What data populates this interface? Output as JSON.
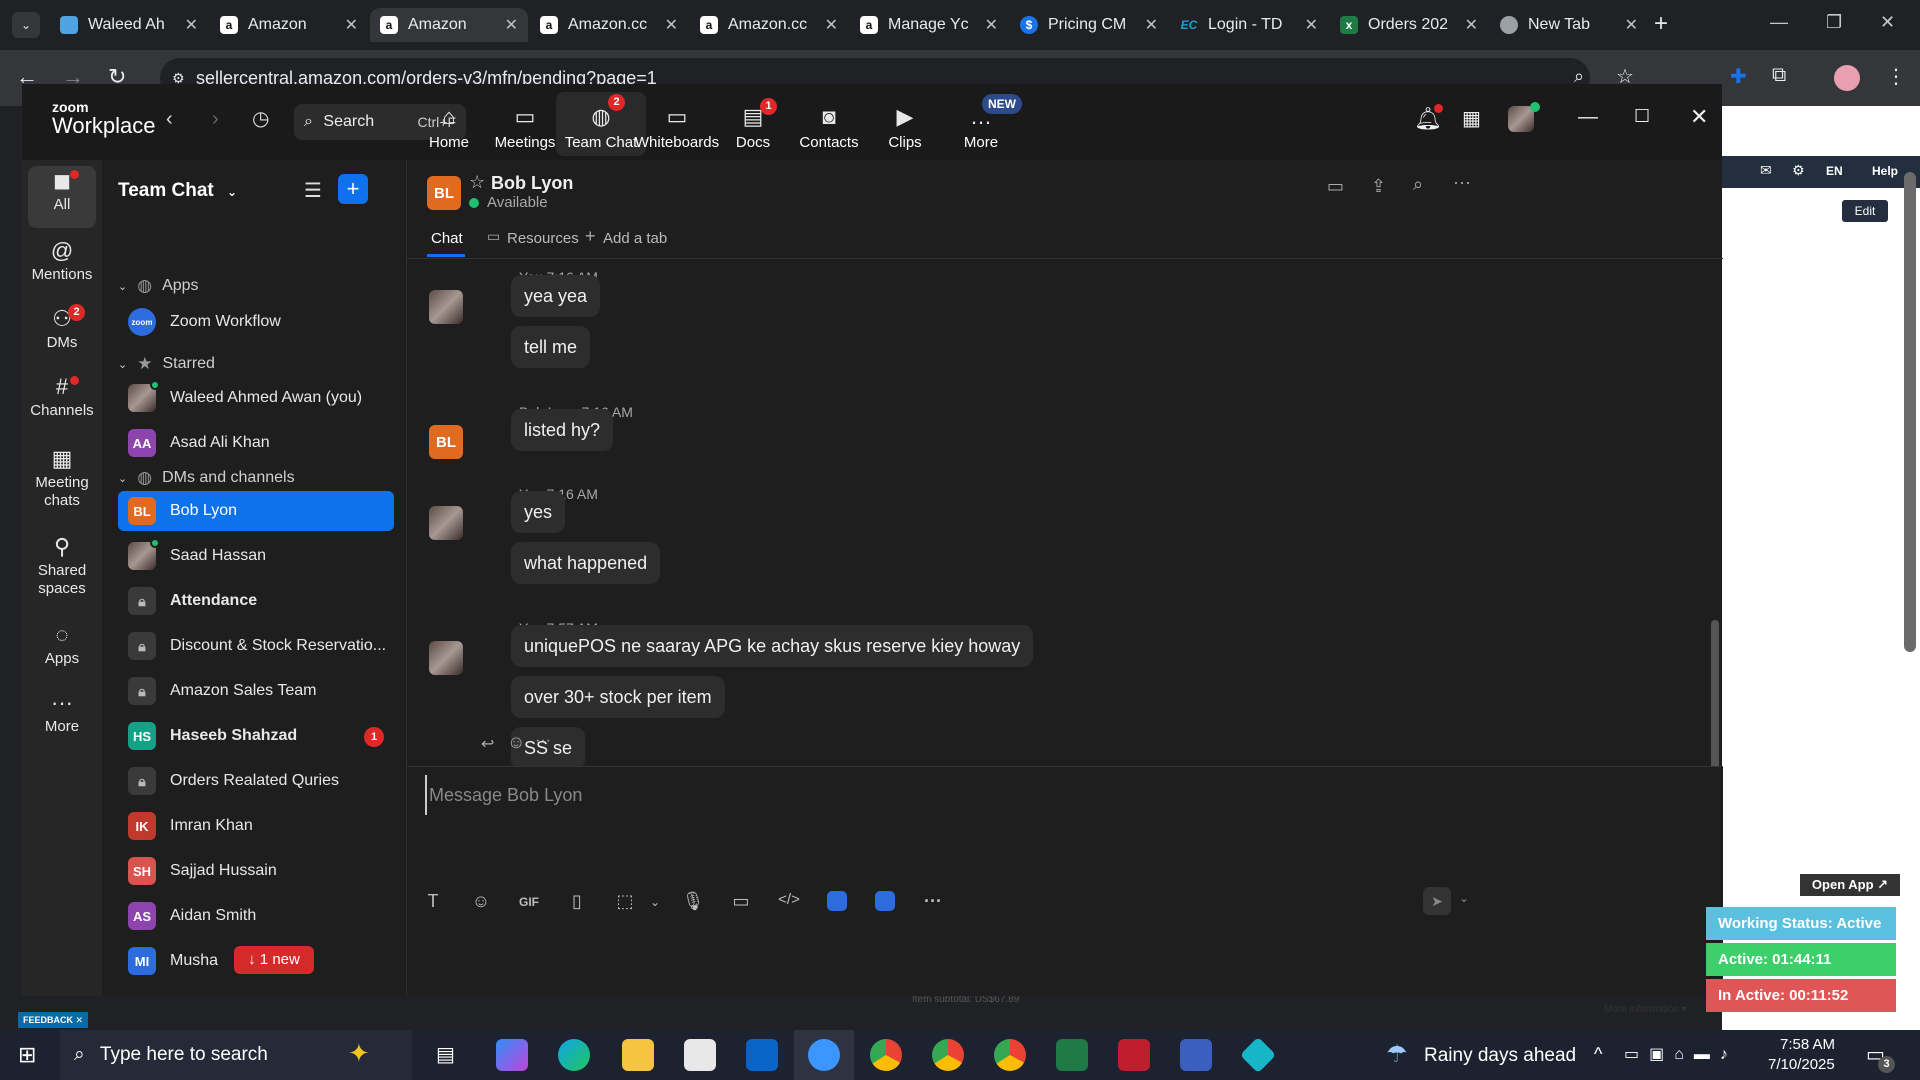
{
  "browser": {
    "tabs": [
      {
        "label": "Waleed Ah",
        "fav": "doc",
        "color": "#4fa3e0"
      },
      {
        "label": "Amazon",
        "fav": "a",
        "color": "#ffffff"
      },
      {
        "label": "Amazon",
        "fav": "a",
        "color": "#ffffff"
      },
      {
        "label": "Amazon.cc",
        "fav": "a",
        "color": "#ffffff"
      },
      {
        "label": "Amazon.cc",
        "fav": "a",
        "color": "#ffffff"
      },
      {
        "label": "Manage Yc",
        "fav": "a",
        "color": "#ffffff"
      },
      {
        "label": "Pricing CM",
        "fav": "$",
        "color": "#1a73e8"
      },
      {
        "label": "Login - TD",
        "fav": "EC",
        "color": "#1a9fd6"
      },
      {
        "label": "Orders 202",
        "fav": "x",
        "color": "#1f7a45"
      },
      {
        "label": "New Tab",
        "fav": "chrome",
        "color": "#9aa0a6"
      }
    ],
    "url": "sellercentral.amazon.com/orders-v3/mfn/pending?page=1"
  },
  "page_behind": {
    "help": "Help",
    "lang": "EN",
    "edit": "Edit",
    "open_app": "Open App ↗",
    "item_subtotal": "Item subtotal: US$67.89",
    "more_info": "More information ▾",
    "feedback": "FEEDBACK ✕"
  },
  "zoom": {
    "logo_top": "zoom",
    "logo_bottom": "Workplace",
    "search_label": "Search",
    "search_shortcut": "Ctrl+F",
    "nav": [
      {
        "label": "Home",
        "icon": "home-icon",
        "glyph": "⌂"
      },
      {
        "label": "Meetings",
        "icon": "video-icon",
        "glyph": "▭"
      },
      {
        "label": "Team Chat",
        "icon": "chat-icon",
        "glyph": "◍",
        "badge": "2"
      },
      {
        "label": "Whiteboards",
        "icon": "whiteboard-icon",
        "glyph": "▭"
      },
      {
        "label": "Docs",
        "icon": "docs-icon",
        "glyph": "▤",
        "badge": "1"
      },
      {
        "label": "Contacts",
        "icon": "contacts-icon",
        "glyph": "◙"
      },
      {
        "label": "Clips",
        "icon": "clips-icon",
        "glyph": "▶"
      },
      {
        "label": "More",
        "icon": "more-icon",
        "glyph": "…",
        "tag": "NEW"
      }
    ],
    "rail": [
      {
        "label": "All",
        "glyph": "◼"
      },
      {
        "label": "Mentions",
        "glyph": "@"
      },
      {
        "label": "DMs",
        "glyph": "⚇",
        "badge": "2"
      },
      {
        "label": "Channels",
        "glyph": "#"
      },
      {
        "label": "Meeting chats",
        "glyph": "▦"
      },
      {
        "label": "Shared spaces",
        "glyph": "⚲"
      },
      {
        "label": "Apps",
        "glyph": "◌"
      },
      {
        "label": "More",
        "glyph": "···"
      }
    ],
    "sidebar": {
      "title": "Team Chat",
      "sections": {
        "apps": "Apps",
        "starred": "Starred",
        "dms": "DMs and channels"
      },
      "apps_items": [
        {
          "label": "Zoom Workflow"
        }
      ],
      "starred_items": [
        {
          "label": "Waleed Ahmed Awan (you)",
          "type": "photo"
        },
        {
          "label": "Asad Ali Khan",
          "initials": "AA",
          "color": "#8e44ad"
        }
      ],
      "dm_items": [
        {
          "label": "Bob Lyon",
          "initials": "BL",
          "color": "#e06a20",
          "selected": true
        },
        {
          "label": "Saad Hassan",
          "type": "photo"
        },
        {
          "label": "Attendance",
          "type": "lock",
          "bold": true
        },
        {
          "label": "Discount & Stock Reservatio...",
          "type": "lock"
        },
        {
          "label": "Amazon Sales Team",
          "type": "lock"
        },
        {
          "label": "Haseeb Shahzad",
          "initials": "HS",
          "color": "#16a085",
          "bold": true,
          "badge": "1"
        },
        {
          "label": "Orders Realated Quries",
          "type": "lock"
        },
        {
          "label": "Imran Khan",
          "initials": "IK",
          "color": "#c0392b"
        },
        {
          "label": "Sajjad Hussain",
          "initials": "SH",
          "color": "#d9534f"
        },
        {
          "label": "Aidan Smith",
          "initials": "AS",
          "color": "#8e44ad"
        },
        {
          "label": "Musha",
          "initials": "MI",
          "color": "#2d6cdf"
        }
      ],
      "new_pill": "↓ 1 new"
    },
    "chat": {
      "contact_name": "Bob Lyon",
      "contact_initials": "BL",
      "contact_status": "Available",
      "tabs": [
        "Chat",
        "Resources",
        "Add a tab"
      ],
      "messages": [
        {
          "meta": "You 7:16 AM",
          "avatar": "photo",
          "bubbles": [
            "yea yea",
            "tell me"
          ]
        },
        {
          "meta": "Bob Lyon 7:16 AM",
          "avatar": "BL",
          "bubbles": [
            "listed hy?"
          ]
        },
        {
          "meta": "You 7:16 AM",
          "avatar": "photo",
          "bubbles": [
            "yes",
            "what happened"
          ]
        },
        {
          "meta": "You 7:57 AM",
          "avatar": "photo",
          "bubbles": [
            "uniquePOS ne saaray APG ke achay skus reserve kiey howay",
            "over 30+ stock per item",
            "SS se"
          ]
        }
      ],
      "composer_placeholder": "Message Bob Lyon",
      "toolbar": [
        "format-icon",
        "emoji-icon",
        "gif-icon",
        "file-icon",
        "screenshot-icon",
        "mic-icon",
        "video-message-icon",
        "code-icon",
        "app-icon",
        "zoom-doc-icon",
        "more-icon"
      ],
      "gif_label": "GIF"
    }
  },
  "overlay": {
    "working_status": "Working Status: Active",
    "active": "Active: 01:44:11",
    "inactive": "In Active: 00:11:52"
  },
  "taskbar": {
    "search_placeholder": "Type here to search",
    "weather": "Rainy days ahead",
    "time": "7:58 AM",
    "date": "7/10/2025",
    "notif_count": "3"
  }
}
